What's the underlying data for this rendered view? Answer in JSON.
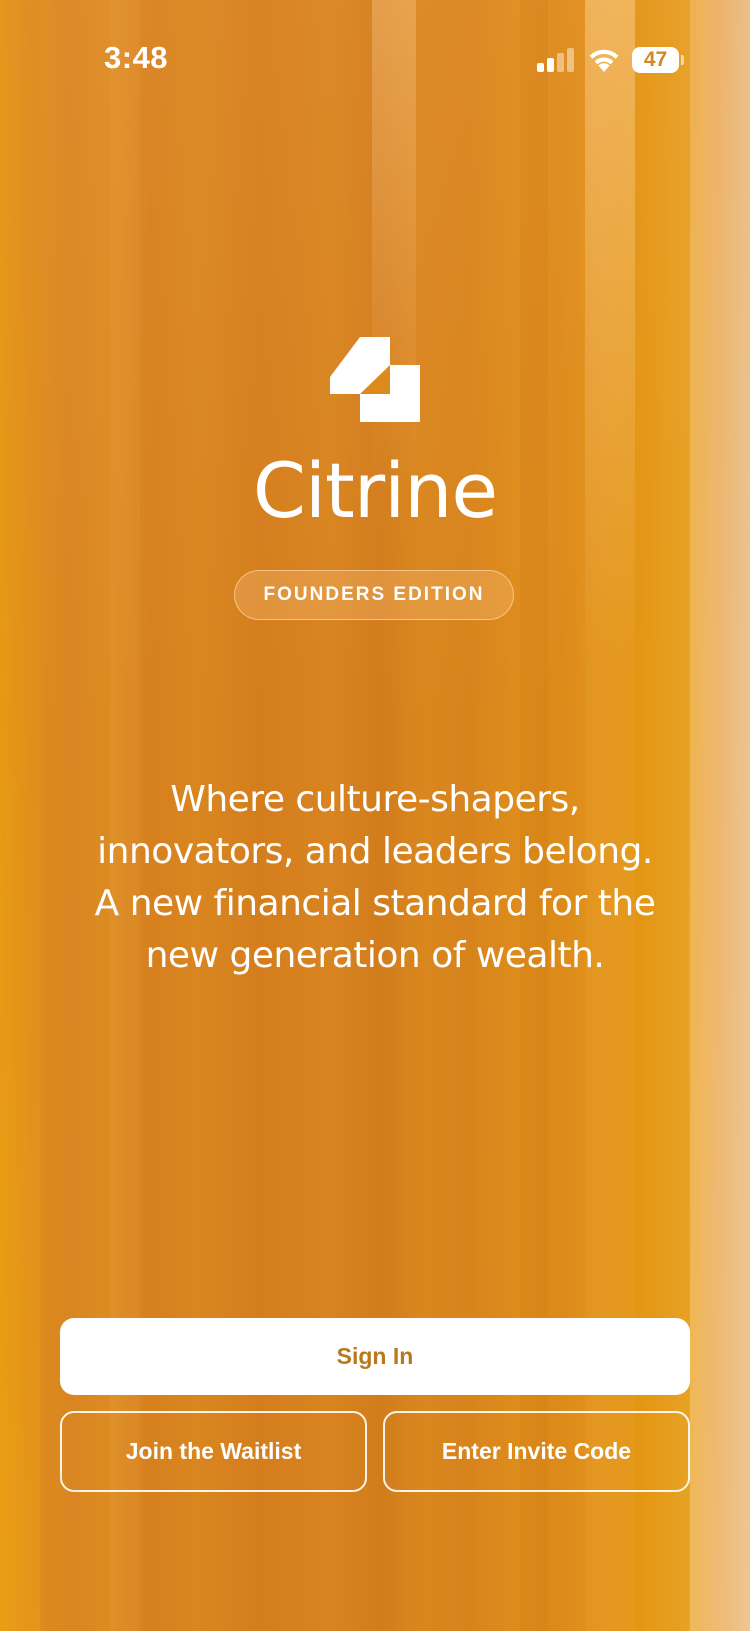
{
  "status_bar": {
    "time": "3:48",
    "battery_level": "47",
    "signal_icon": "cellular-signal-icon",
    "wifi_icon": "wifi-icon",
    "battery_icon": "battery-icon"
  },
  "brand": {
    "logo_icon": "citrine-logo-icon",
    "name": "Citrine",
    "edition_badge": "FOUNDERS EDITION"
  },
  "tagline": {
    "lines": [
      "Where culture-shapers,",
      "innovators, and leaders belong.",
      "A new financial standard for the",
      "new generation of wealth."
    ]
  },
  "actions": {
    "sign_in": "Sign In",
    "join_waitlist": "Join the Waitlist",
    "enter_invite_code": "Enter Invite Code"
  },
  "colors": {
    "background": "#dc8a1c",
    "primary_button_bg": "#ffffff",
    "primary_button_text": "#b8791c",
    "text": "#ffffff"
  }
}
